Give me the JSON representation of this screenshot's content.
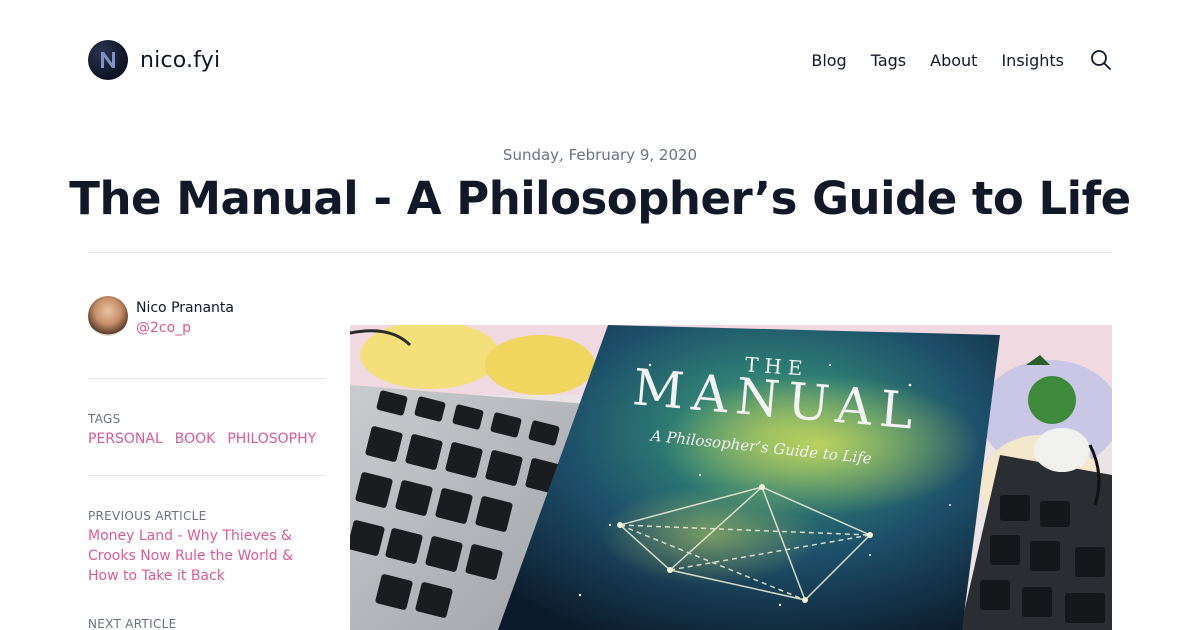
{
  "site": {
    "name": "nico.fyi"
  },
  "nav": {
    "items": [
      "Blog",
      "Tags",
      "About",
      "Insights"
    ]
  },
  "post": {
    "date": "Sunday, February 9, 2020",
    "title": "The Manual - A Philosopher’s Guide to Life"
  },
  "author": {
    "name": "Nico Prananta",
    "handle": "@2co_p"
  },
  "tags": {
    "label": "TAGS",
    "items": [
      "PERSONAL",
      "BOOK",
      "PHILOSOPHY"
    ]
  },
  "previous": {
    "label": "PREVIOUS ARTICLE",
    "title": "Money Land - Why Thieves & Crooks Now Rule the World & How to Take it Back"
  },
  "next": {
    "label": "NEXT ARTICLE"
  },
  "hero_image": {
    "cover_title_top": "THE",
    "cover_title_main": "MANUAL",
    "cover_subtitle": "A Philosopher’s Guide to Life"
  },
  "colors": {
    "accent": "#db5a9a",
    "text": "#111827",
    "muted": "#6b7280",
    "rule": "#e5e7eb"
  },
  "icons": {
    "logo": "n-logo-icon",
    "search": "search-icon"
  }
}
